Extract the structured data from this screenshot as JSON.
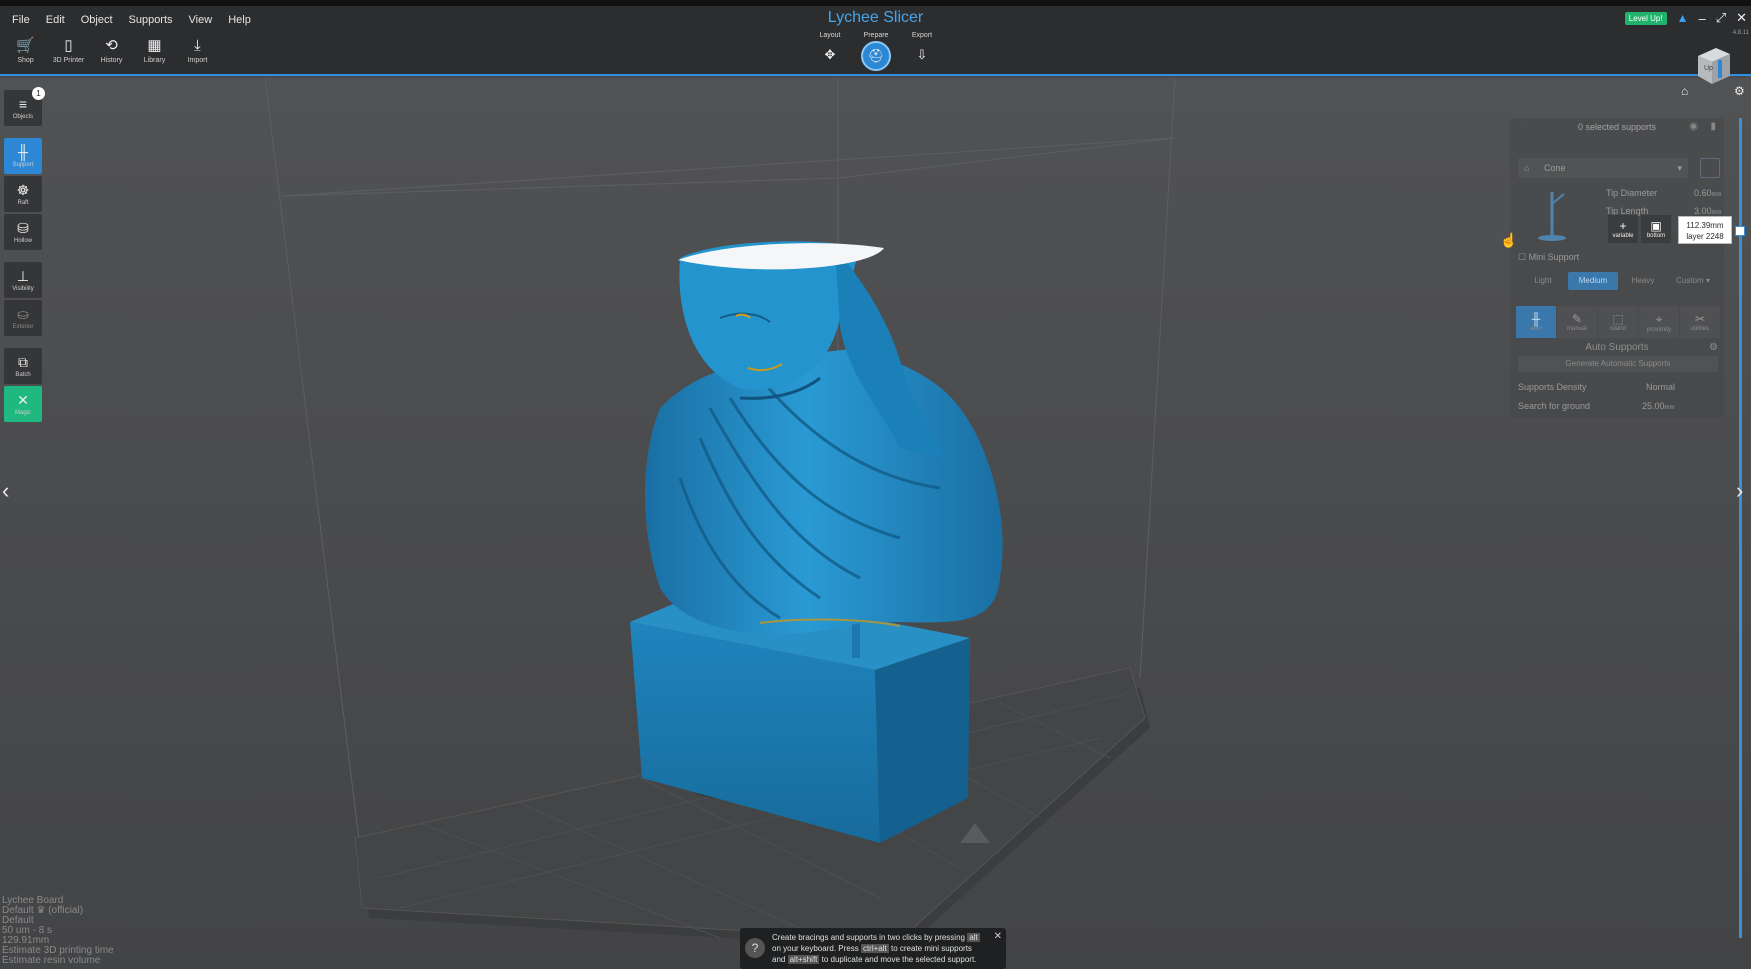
{
  "app_title": "Lychee Slicer",
  "version": "4.8.11",
  "menu": [
    "File",
    "Edit",
    "Object",
    "Supports",
    "View",
    "Help"
  ],
  "toolbar": [
    {
      "icon": "cart-icon",
      "label": "Shop",
      "glyph": "🛒"
    },
    {
      "icon": "printer-icon",
      "label": "3D Printer",
      "glyph": "▯"
    },
    {
      "icon": "history-icon",
      "label": "History",
      "glyph": "⟲"
    },
    {
      "icon": "library-icon",
      "label": "Library",
      "glyph": "▦"
    },
    {
      "icon": "import-icon",
      "label": "Import",
      "glyph": "⤓"
    }
  ],
  "modes": [
    {
      "label": "Layout",
      "glyph": "✥",
      "active": false
    },
    {
      "label": "Prepare",
      "glyph": "⛑",
      "active": true
    },
    {
      "label": "Export",
      "glyph": "⇩",
      "active": false
    }
  ],
  "level_up": "Level Up!",
  "sidebar": [
    {
      "name": "objects",
      "label": "Objects",
      "glyph": "≡",
      "badge": "1"
    },
    {
      "name": "support",
      "label": "Support",
      "glyph": "╫",
      "active": true
    },
    {
      "name": "raft",
      "label": "Raft",
      "glyph": "☸"
    },
    {
      "name": "hollow",
      "label": "Hollow",
      "glyph": "⛁"
    },
    {
      "name": "visibility",
      "label": "Visibility",
      "glyph": "⊥"
    },
    {
      "name": "exterior",
      "label": "Exterior",
      "glyph": "⛀",
      "dim": true
    },
    {
      "name": "batch",
      "label": "Batch",
      "glyph": "⧉"
    },
    {
      "name": "magic",
      "label": "Magic",
      "glyph": "✕",
      "magic": true
    }
  ],
  "panel": {
    "selected": "0 selected supports",
    "support_type": "Cone",
    "tip_diameter_label": "Tip Diameter",
    "tip_diameter_value": "0.60",
    "tip_length_label": "Tip Length",
    "tip_length_value": "3.00",
    "mini_support": "Mini Support",
    "density_options": [
      "Light",
      "Medium",
      "Heavy",
      "Custom"
    ],
    "density_selected": "Medium",
    "tabs": [
      {
        "label": "auto",
        "glyph": "╫",
        "on": true
      },
      {
        "label": "manual",
        "glyph": "✎"
      },
      {
        "label": "island",
        "glyph": "⬚"
      },
      {
        "label": "proximity",
        "glyph": "⌖"
      },
      {
        "label": "utilities",
        "glyph": "✂"
      }
    ],
    "auto_supports": "Auto Supports",
    "generate": "Generate Automatic Supports",
    "supports_density_label": "Supports Density",
    "supports_density_value": "Normal",
    "search_ground_label": "Search for ground",
    "search_ground_value": "25.00",
    "unit": "mm"
  },
  "float_tools": [
    {
      "label": "variable",
      "glyph": "+"
    },
    {
      "label": "bottom",
      "glyph": "▣"
    }
  ],
  "layer_tip": {
    "height": "112.39mm",
    "layer": "layer 2248"
  },
  "info": [
    "Lychee Board",
    "Default ♛ (official)",
    "Default",
    "50 um - 8 s",
    "129.91mm",
    "Estimate 3D printing time",
    "Estimate resin volume"
  ],
  "hint": {
    "line1a": "Create bracings and supports in two clicks by pressing",
    "key1": "alt",
    "line2a": "on your keyboard. Press",
    "key2": "ctrl+alt",
    "line2b": "to create mini supports",
    "line3a": "and",
    "key3": "alt+shift",
    "line3b": "to duplicate and move the selected support."
  },
  "cube_face": "Up",
  "colors": {
    "accent": "#2c88d4",
    "model": "#1e90cc",
    "magic": "#1eb880",
    "level_up": "#21b36b"
  }
}
